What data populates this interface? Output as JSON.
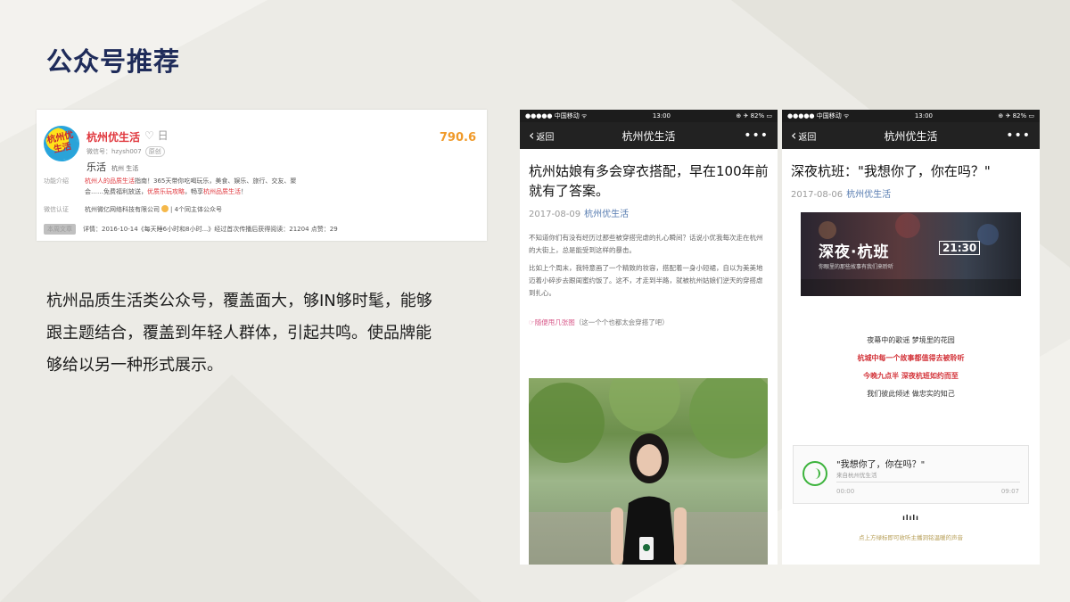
{
  "slide": {
    "title": "公众号推荐",
    "description": [
      "杭州品质生活类公众号，覆盖面大，够IN够时髦，能够",
      "跟主题结合，覆盖到年轻人群体，引起共鸣。使品牌能",
      "够给以另一种形式展示。"
    ]
  },
  "profile": {
    "avatar_text": "杭州优生活",
    "name": "杭州优生活",
    "heart": "♡ 日",
    "score": "790.6",
    "wechat_id": "微信号：hzysh007",
    "wechat_tag": "原创",
    "category": "乐活",
    "tags": "杭州  生活",
    "intro_label": "功能介绍",
    "intro_line1_pre": "杭州人",
    "intro_line1_red": "的品质生活",
    "intro_line1_post": "指南！365天带你吃喝玩乐，美食、娱乐、旅行、交友、聚",
    "intro_line2_pre": "会……免费福利放送，",
    "intro_line2_red": "优质乐玩攻略",
    "intro_line2_mid": "，畅享",
    "intro_line2_red2": "杭州品质生活",
    "intro_line2_post": "！",
    "cert_label": "微信认证",
    "cert_value": "杭州微亿网络科技有限公司",
    "cert_extra": "| 4个同主体公众号",
    "history_label": "本周文章",
    "history_value": "详情：2016-10-14《每天睡6小时和8小时...》经过首次传播后获得阅读：21204 点赞：29"
  },
  "phone_left": {
    "carrier": "●●●●● 中国移动 ᯤ",
    "time": "13:00",
    "battery": "⊕ ✈ 82% ▭",
    "back_label": "返回",
    "nav_title": "杭州优生活",
    "more": "•••",
    "article_title": "杭州姑娘有多会穿衣搭配，早在100年前就有了答案。",
    "date": "2017-08-09",
    "source": "杭州优生活",
    "paragraphs": [
      "不知道你们有没有经历过那些被穿搭完虐的扎心瞬间？话说小优我每次走在杭州的大街上，总是能受到这样的暴击。",
      "比如上个周末，我特意画了一个精致的妆容，搭配着一身小短裙，自以为美美地迈着小碎步去跟闺蜜约饭了。这不，才走到半路，就被杭州姑娘们逆天的穿搭虐到扎心。"
    ],
    "link_pink": "☞随便甩几张图",
    "link_rest": "（这一个个也都太会穿搭了吧）"
  },
  "phone_right": {
    "carrier": "●●●●● 中国移动 ᯤ",
    "time": "13:00",
    "battery": "⊕ ✈ 82% ▭",
    "back_label": "返回",
    "nav_title": "杭州优生活",
    "more": "•••",
    "article_title": "深夜杭班：\"我想你了，你在吗？\"",
    "date": "2017-08-06",
    "source": "杭州优生活",
    "banner_title": "深夜·杭班",
    "banner_time": "21:30",
    "banner_sub": "你眼里的那些故事有我们来聆听",
    "poem": [
      "夜幕中的歌谣  梦境里的花园",
      "杭城中每一个故事都值得去被聆听",
      "今晚九点半  深夜杭班如约而至",
      "我们彼此倾述  做忠实的知己"
    ],
    "audio_title": "\"我想你了，你在吗？\"",
    "audio_source": "来自杭州优生活",
    "audio_start": "00:00",
    "audio_end": "09:07",
    "logo": "ılılı",
    "footer": "点上方绿标即可收听主播洞铭温暖的声音"
  },
  "colors": {
    "title": "#1f2c5a",
    "accent_red": "#e0353b",
    "score_orange": "#f09a2a",
    "link_blue": "#567bb0",
    "audio_green": "#3cb33c"
  }
}
